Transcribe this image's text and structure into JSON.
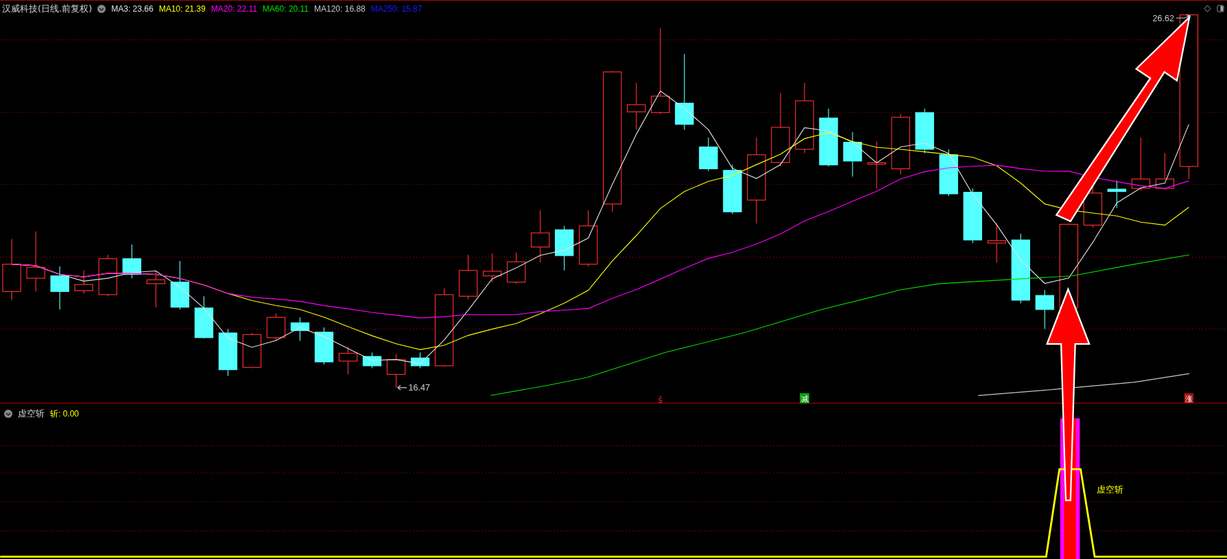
{
  "chart_header": {
    "title": "汉威科技(日线.前复权)",
    "indicators": [
      {
        "label": "MA3: 23.66",
        "color": "#e0e0e0"
      },
      {
        "label": "MA10: 21.39",
        "color": "#ffff00"
      },
      {
        "label": "MA20: 22.11",
        "color": "#ff00ff"
      },
      {
        "label": "MA60: 20.11",
        "color": "#00e000"
      },
      {
        "label": "MA120: 16.88",
        "color": "#c8c8c8"
      },
      {
        "label": "MA250: 15.87",
        "color": "#1a1aff"
      }
    ]
  },
  "price_labels": {
    "high": "26.62",
    "low": "16.47"
  },
  "signals": [
    {
      "text": "ŝ",
      "kind": "plain",
      "color": "#ff2020"
    },
    {
      "text": "减",
      "kind": "boxed",
      "color": "#10a010"
    },
    {
      "text": "涨",
      "kind": "boxed",
      "color": "#a01010"
    }
  ],
  "indicator_pane": {
    "title": "虚空斩",
    "readout": "斩: 0.00",
    "signal_label": "虚空斩"
  }
}
